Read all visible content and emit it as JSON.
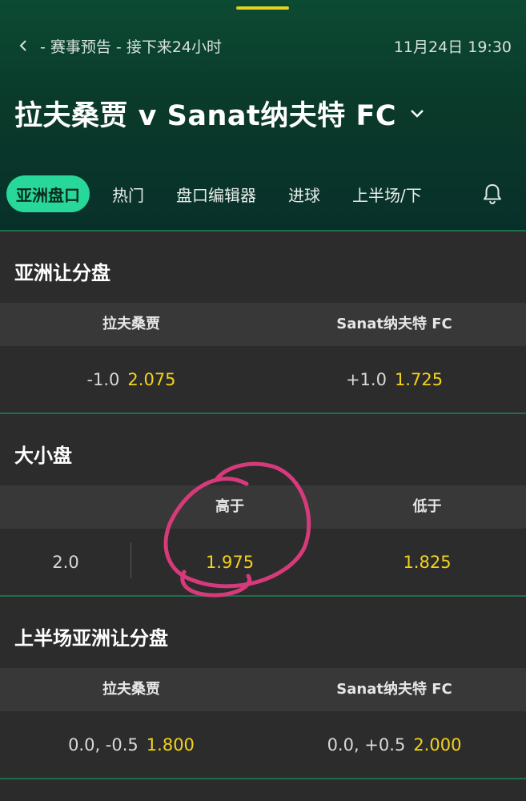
{
  "header": {
    "breadcrumb": "- 赛事预告 - 接下来24小时",
    "datetime": "11月24日 19:30",
    "match_title": "拉夫桑贾 v Sanat纳夫特 FC"
  },
  "tabs": [
    {
      "label": "亚洲盘口",
      "active": true
    },
    {
      "label": "热门"
    },
    {
      "label": "盘口编辑器"
    },
    {
      "label": "进球"
    },
    {
      "label": "上半场/下"
    }
  ],
  "asian_handicap": {
    "title": "亚洲让分盘",
    "home_name": "拉夫桑贾",
    "away_name": "Sanat纳夫特 FC",
    "home_line": "-1.0",
    "home_price": "2.075",
    "away_line": "+1.0",
    "away_price": "1.725"
  },
  "over_under": {
    "title": "大小盘",
    "over_label": "高于",
    "under_label": "低于",
    "line": "2.0",
    "over_price": "1.975",
    "under_price": "1.825"
  },
  "first_half_handicap": {
    "title": "上半场亚洲让分盘",
    "home_name": "拉夫桑贾",
    "away_name": "Sanat纳夫特 FC",
    "home_line": "0.0, -0.5",
    "home_price": "1.800",
    "away_line": "0.0, +0.5",
    "away_price": "2.000"
  },
  "colors": {
    "accent_green": "#27d89a",
    "price_yellow": "#f3d21a",
    "annotation_pink": "#d63a7a"
  },
  "icons": [
    "back-icon",
    "chevron-down-icon",
    "bell-icon"
  ]
}
